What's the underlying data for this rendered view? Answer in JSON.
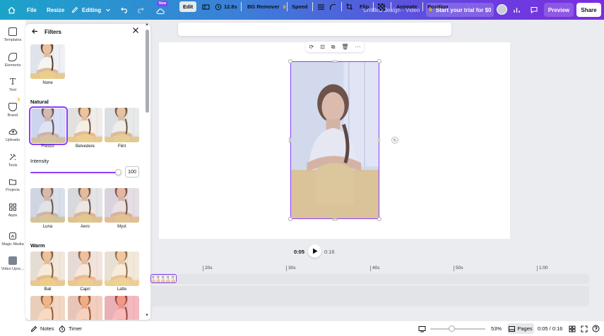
{
  "topbar": {
    "file_label": "File",
    "resize_label": "Resize",
    "editing_label": "Editing",
    "new_badge": "New",
    "design_title": "Untitled design - Video",
    "trial_label": "Start your trial for $0",
    "preview_label": "Preview",
    "share_label": "Share"
  },
  "rail": {
    "items": [
      {
        "label": "Templates"
      },
      {
        "label": "Elements"
      },
      {
        "label": "Text"
      },
      {
        "label": "Brand"
      },
      {
        "label": "Uploads"
      },
      {
        "label": "Tools"
      },
      {
        "label": "Projects"
      },
      {
        "label": "Apps"
      },
      {
        "label": "Magic Media"
      },
      {
        "label": "Video Upsc..."
      }
    ]
  },
  "panel": {
    "title": "Filters",
    "none_label": "None",
    "natural_label": "Natural",
    "natural": [
      {
        "label": "Fresco"
      },
      {
        "label": "Belvedere"
      },
      {
        "label": "Flint"
      }
    ],
    "intensity_label": "Intensity",
    "intensity_value": "100",
    "intensity_level": 0.95,
    "row2": [
      {
        "label": "Luna"
      },
      {
        "label": "Aero"
      },
      {
        "label": "Myst"
      }
    ],
    "warm_label": "Warm",
    "warm": [
      {
        "label": "Bali"
      },
      {
        "label": "Capri"
      },
      {
        "label": "Latte"
      }
    ]
  },
  "ctxbar": {
    "edit_label": "Edit",
    "duration_label": "12.8s",
    "bg_remover_label": "BG Remover",
    "speed_label": "Speed",
    "flip_label": "Flip",
    "animate_label": "Animate",
    "position_label": "Position"
  },
  "playback": {
    "current": "0:05",
    "total": "0:16"
  },
  "timeline": {
    "ticks": [
      "20s",
      "30s",
      "40s",
      "50s",
      "1:00"
    ]
  },
  "bottombar": {
    "notes_label": "Notes",
    "timer_label": "Timer",
    "zoom_label": "53%",
    "zoom_level": 0.38,
    "pages_label": "Pages",
    "time_label": "0:05 / 0:16"
  },
  "colors": {
    "accent": "#8b3dff",
    "gradient_start": "#1ca3c9",
    "gradient_end": "#7b2ee0"
  }
}
